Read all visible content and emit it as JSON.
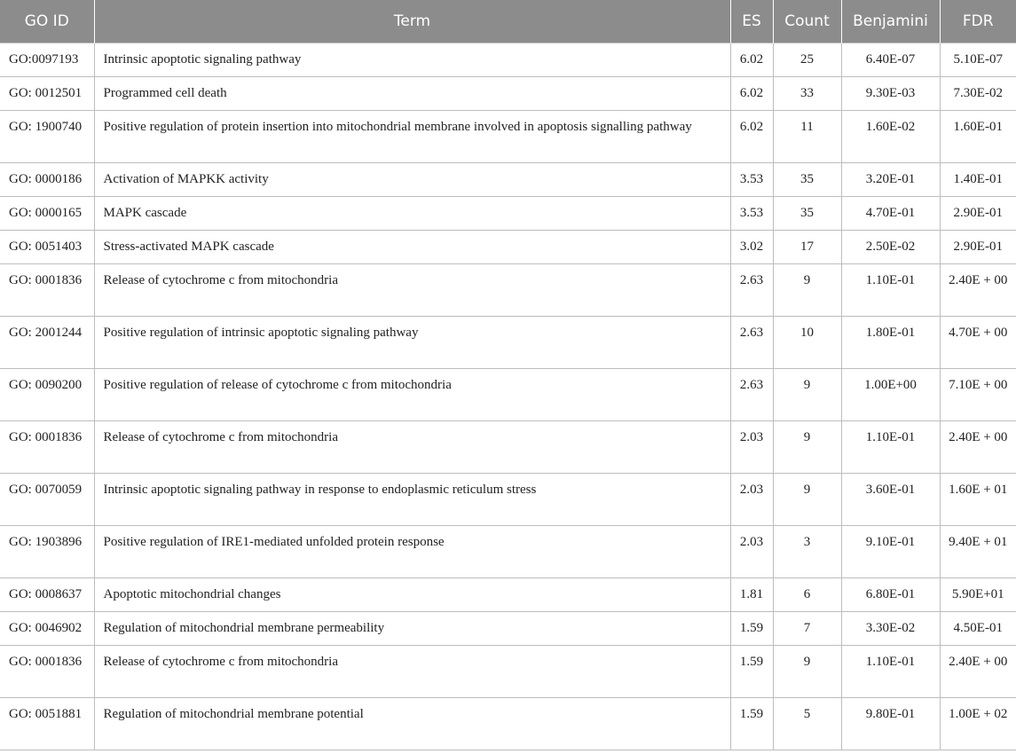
{
  "table": {
    "headers": [
      "GO ID",
      "Term",
      "ES",
      "Count",
      "Benjamini",
      "FDR"
    ],
    "rows": [
      {
        "go_id": "GO:0097193",
        "term": "Intrinsic apoptotic signaling pathway",
        "es": "6.02",
        "count": "25",
        "benjamini": "6.40E-07",
        "fdr": "5.10E-07"
      },
      {
        "go_id": "GO: 0012501",
        "term": "Programmed cell death",
        "es": "6.02",
        "count": "33",
        "benjamini": "9.30E-03",
        "fdr": "7.30E-02"
      },
      {
        "go_id": "GO: 1900740",
        "term": "Positive regulation of protein insertion into mitochondrial membrane involved in apoptosis signalling pathway",
        "es": "6.02",
        "count": "11",
        "benjamini": "1.60E-02",
        "fdr": "1.60E-01"
      },
      {
        "go_id": "GO: 0000186",
        "term": "Activation of MAPKK activity",
        "es": "3.53",
        "count": "35",
        "benjamini": "3.20E-01",
        "fdr": "1.40E-01"
      },
      {
        "go_id": "GO: 0000165",
        "term": "MAPK cascade",
        "es": "3.53",
        "count": "35",
        "benjamini": "4.70E-01",
        "fdr": "2.90E-01"
      },
      {
        "go_id": "GO: 0051403",
        "term": "Stress-activated MAPK cascade",
        "es": "3.02",
        "count": "17",
        "benjamini": "2.50E-02",
        "fdr": "2.90E-01"
      },
      {
        "go_id": "GO: 0001836",
        "term": "Release of cytochrome c from mitochondria",
        "es": "2.63",
        "count": "9",
        "benjamini": "1.10E-01",
        "fdr": "2.40E + 00"
      },
      {
        "go_id": "GO: 2001244",
        "term": "Positive regulation of intrinsic apoptotic signaling pathway",
        "es": "2.63",
        "count": "10",
        "benjamini": "1.80E-01",
        "fdr": "4.70E + 00"
      },
      {
        "go_id": "GO: 0090200",
        "term": "Positive regulation of release of cytochrome c from mitochondria",
        "es": "2.63",
        "count": "9",
        "benjamini": "1.00E+00",
        "fdr": "7.10E + 00"
      },
      {
        "go_id": "GO: 0001836",
        "term": "Release of cytochrome c from mitochondria",
        "es": "2.03",
        "count": "9",
        "benjamini": "1.10E-01",
        "fdr": "2.40E + 00"
      },
      {
        "go_id": "GO: 0070059",
        "term": "Intrinsic apoptotic signaling pathway in response to endoplasmic reticulum stress",
        "es": "2.03",
        "count": "9",
        "benjamini": "3.60E-01",
        "fdr": "1.60E + 01"
      },
      {
        "go_id": "GO: 1903896",
        "term": "Positive regulation of IRE1-mediated unfolded protein response",
        "es": "2.03",
        "count": "3",
        "benjamini": "9.10E-01",
        "fdr": "9.40E + 01"
      },
      {
        "go_id": "GO: 0008637",
        "term": "Apoptotic mitochondrial changes",
        "es": "1.81",
        "count": "6",
        "benjamini": "6.80E-01",
        "fdr": "5.90E+01"
      },
      {
        "go_id": "GO: 0046902",
        "term": "Regulation of mitochondrial membrane permeability",
        "es": "1.59",
        "count": "7",
        "benjamini": "3.30E-02",
        "fdr": "4.50E-01"
      },
      {
        "go_id": "GO: 0001836",
        "term": "Release of cytochrome c from mitochondria",
        "es": "1.59",
        "count": "9",
        "benjamini": "1.10E-01",
        "fdr": "2.40E + 00"
      },
      {
        "go_id": "GO: 0051881",
        "term": "Regulation of mitochondrial membrane potential",
        "es": "1.59",
        "count": "5",
        "benjamini": "9.80E-01",
        "fdr": "1.00E + 02"
      }
    ]
  }
}
